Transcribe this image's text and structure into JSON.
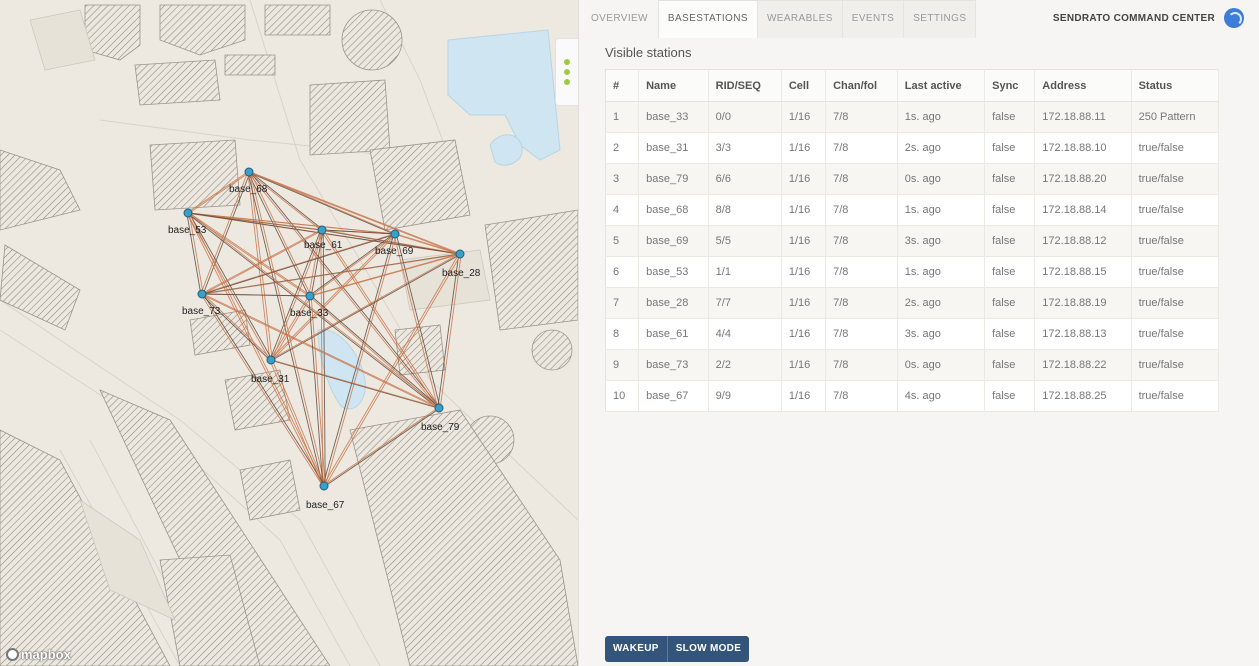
{
  "tabs": [
    {
      "label": "OVERVIEW"
    },
    {
      "label": "BASESTATIONS"
    },
    {
      "label": "WEARABLES"
    },
    {
      "label": "EVENTS"
    },
    {
      "label": "SETTINGS"
    }
  ],
  "header": {
    "title": "SENDRATO COMMAND CENTER"
  },
  "section_title": "Visible stations",
  "table": {
    "columns": [
      "#",
      "Name",
      "RID/SEQ",
      "Cell",
      "Chan/fol",
      "Last active",
      "Sync",
      "Address",
      "Status"
    ],
    "rows": [
      [
        "1",
        "base_33",
        "0/0",
        "1/16",
        "7/8",
        "1s. ago",
        "false",
        "172.18.88.11",
        "250 Pattern"
      ],
      [
        "2",
        "base_31",
        "3/3",
        "1/16",
        "7/8",
        "2s. ago",
        "false",
        "172.18.88.10",
        "true/false"
      ],
      [
        "3",
        "base_79",
        "6/6",
        "1/16",
        "7/8",
        "0s. ago",
        "false",
        "172.18.88.20",
        "true/false"
      ],
      [
        "4",
        "base_68",
        "8/8",
        "1/16",
        "7/8",
        "1s. ago",
        "false",
        "172.18.88.14",
        "true/false"
      ],
      [
        "5",
        "base_69",
        "5/5",
        "1/16",
        "7/8",
        "3s. ago",
        "false",
        "172.18.88.12",
        "true/false"
      ],
      [
        "6",
        "base_53",
        "1/1",
        "1/16",
        "7/8",
        "1s. ago",
        "false",
        "172.18.88.15",
        "true/false"
      ],
      [
        "7",
        "base_28",
        "7/7",
        "1/16",
        "7/8",
        "2s. ago",
        "false",
        "172.18.88.19",
        "true/false"
      ],
      [
        "8",
        "base_61",
        "4/4",
        "1/16",
        "7/8",
        "3s. ago",
        "false",
        "172.18.88.13",
        "true/false"
      ],
      [
        "9",
        "base_73",
        "2/2",
        "1/16",
        "7/8",
        "0s. ago",
        "false",
        "172.18.88.22",
        "true/false"
      ],
      [
        "10",
        "base_67",
        "9/9",
        "1/16",
        "7/8",
        "4s. ago",
        "false",
        "172.18.88.25",
        "true/false"
      ]
    ]
  },
  "buttons": {
    "wakeup": "WAKEUP",
    "slow_mode": "SLOW MODE"
  },
  "map": {
    "logo": "mapbox",
    "stations": [
      "base_68",
      "base_53",
      "base_61",
      "base_69",
      "base_28",
      "base_73",
      "base_33",
      "base_31",
      "base_79",
      "base_67"
    ]
  },
  "colors": {
    "accent": "#34557a",
    "link_line": "#c8764a",
    "link_line_dark": "#5a4a40",
    "station_dot": "#3aa0c8",
    "water": "#cfe6f2",
    "active_dot": "#9ccc40"
  }
}
